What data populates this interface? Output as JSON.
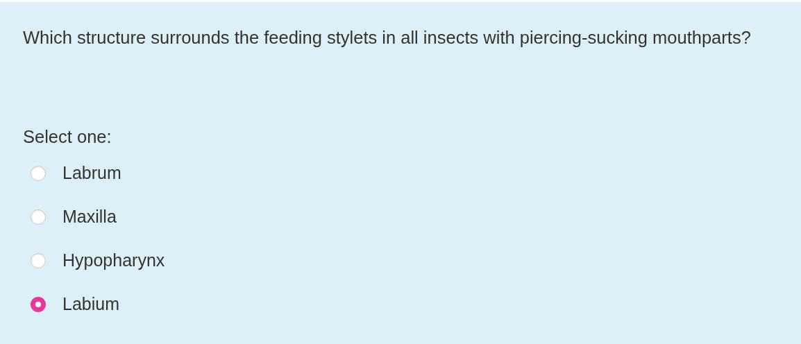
{
  "question": {
    "text": "Which structure surrounds the feeding stylets in all insects with piercing-sucking mouthparts?",
    "prompt": "Select one:",
    "options": [
      {
        "label": "Labrum",
        "selected": false
      },
      {
        "label": "Maxilla",
        "selected": false
      },
      {
        "label": "Hypopharynx",
        "selected": false
      },
      {
        "label": "Labium",
        "selected": true
      }
    ]
  }
}
